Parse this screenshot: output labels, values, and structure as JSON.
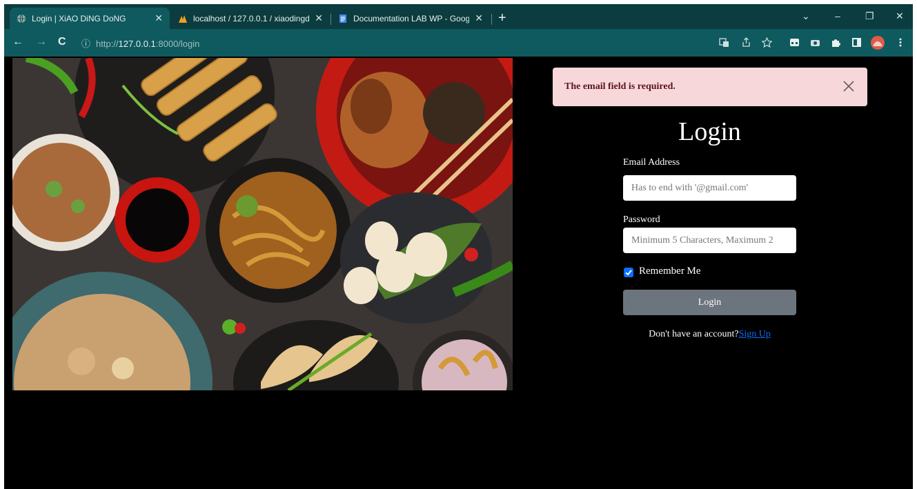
{
  "browser": {
    "tabs": [
      {
        "title": "Login | XiAO DiNG DoNG",
        "close": "✕",
        "active": true
      },
      {
        "title": "localhost / 127.0.0.1 / xiaodingd",
        "close": "✕",
        "active": false
      },
      {
        "title": "Documentation LAB WP - Goog",
        "close": "✕",
        "active": false
      }
    ],
    "new_tab": "+",
    "window_controls": [
      "⌄",
      "–",
      "❐",
      "✕"
    ],
    "nav": {
      "back": "←",
      "forward": "→",
      "reload": "C"
    },
    "url": {
      "info": "ⓘ",
      "prefix": "http://",
      "host": "127.0.0.1",
      "rest": ":8000/login"
    },
    "toolbar_icons": [
      "translate-icon",
      "share-icon",
      "star-icon",
      "extension-icon",
      "camera-icon",
      "puzzle-icon",
      "sidepanel-icon",
      "profile-avatar",
      "menu-icon"
    ]
  },
  "alert": {
    "message": "The email field is required.",
    "close": "close-icon"
  },
  "form": {
    "title": "Login",
    "email_label": "Email Address",
    "email_placeholder": "Has to end with '@gmail.com'",
    "email_value": "",
    "password_label": "Password",
    "password_placeholder": "Minimum 5 Characters, Maximum 2",
    "password_value": "",
    "remember_label": "Remember Me",
    "remember_checked": true,
    "submit_label": "Login",
    "signup_prompt": "Don't have an account?",
    "signup_link": "Sign Up"
  },
  "colors": {
    "tabbar": "#0b3c3f",
    "toolbar": "#0f5a5e",
    "alert_bg": "#f8d7da",
    "alert_text": "#58151c",
    "button": "#6c757d",
    "link": "#0d6efd",
    "page_bg": "#000000"
  }
}
